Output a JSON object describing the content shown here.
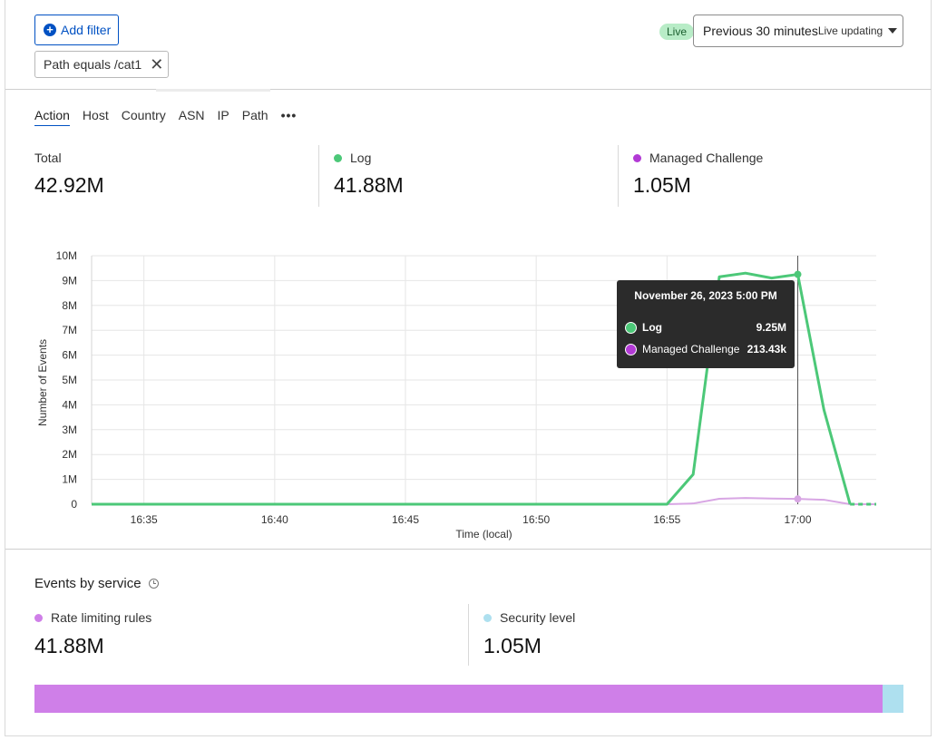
{
  "filters": {
    "add_filter_label": "Add filter",
    "active_filter_label": "Path equals /cat1"
  },
  "time_range": {
    "live_badge": "Live",
    "selected": "Previous 30 minutes",
    "sub_label": "Live updating"
  },
  "tabs": [
    {
      "label": "Action",
      "active": true
    },
    {
      "label": "Host",
      "active": false
    },
    {
      "label": "Country",
      "active": false
    },
    {
      "label": "ASN",
      "active": false
    },
    {
      "label": "IP",
      "active": false
    },
    {
      "label": "Path",
      "active": false
    }
  ],
  "tab_more_label": "•••",
  "stats": [
    {
      "label": "Total",
      "value": "42.92M",
      "dot_color": null
    },
    {
      "label": "Log",
      "value": "41.88M",
      "dot_color": "#4cc878"
    },
    {
      "label": "Managed Challenge",
      "value": "1.05M",
      "dot_color": "#b23ad5"
    }
  ],
  "chart_data": {
    "type": "line",
    "xlabel": "Time (local)",
    "ylabel": "Number of Events",
    "ylim": [
      0,
      10000000
    ],
    "y_ticks": [
      "0",
      "1M",
      "2M",
      "3M",
      "4M",
      "5M",
      "6M",
      "7M",
      "8M",
      "9M",
      "10M"
    ],
    "x_ticks": [
      "16:35",
      "16:40",
      "16:45",
      "16:50",
      "16:55",
      "17:00"
    ],
    "x_unit": "minutes",
    "x_range": [
      "16:33",
      "17:03"
    ],
    "grid": true,
    "series": [
      {
        "name": "Log",
        "color": "#4cc878",
        "points": [
          [
            "16:33",
            0
          ],
          [
            "16:55",
            0
          ],
          [
            "16:56",
            1200000
          ],
          [
            "16:57",
            9150000
          ],
          [
            "16:58",
            9300000
          ],
          [
            "16:59",
            9100000
          ],
          [
            "17:00",
            9250000
          ],
          [
            "17:01",
            3800000
          ],
          [
            "17:02",
            0
          ],
          [
            "17:03",
            0
          ]
        ],
        "dashed_from": "17:02"
      },
      {
        "name": "Managed Challenge",
        "color": "#d8a6e4",
        "points": [
          [
            "16:33",
            0
          ],
          [
            "16:55",
            0
          ],
          [
            "16:56",
            30000
          ],
          [
            "16:57",
            220000
          ],
          [
            "16:58",
            250000
          ],
          [
            "16:59",
            230000
          ],
          [
            "17:00",
            213430
          ],
          [
            "17:01",
            180000
          ],
          [
            "17:02",
            0
          ],
          [
            "17:03",
            0
          ]
        ]
      }
    ],
    "hover_marker_x": "17:00",
    "tooltip": {
      "title": "November 26, 2023 5:00 PM",
      "rows": [
        {
          "name": "Log",
          "value": "9.25M",
          "color": "#4cc878"
        },
        {
          "name": "Managed Challenge",
          "value": "213.43k",
          "color": "#b23ad5"
        }
      ]
    }
  },
  "events_by_service": {
    "title": "Events by service",
    "services": [
      {
        "label": "Rate limiting rules",
        "value": "41.88M",
        "dot_color": "#cf7fe8"
      },
      {
        "label": "Security level",
        "value": "1.05M",
        "dot_color": "#aee0ef"
      }
    ],
    "bar_fractions": [
      0.9755,
      0.0245
    ],
    "bar_colors": [
      "#cf7fe8",
      "#aee0ef"
    ]
  }
}
